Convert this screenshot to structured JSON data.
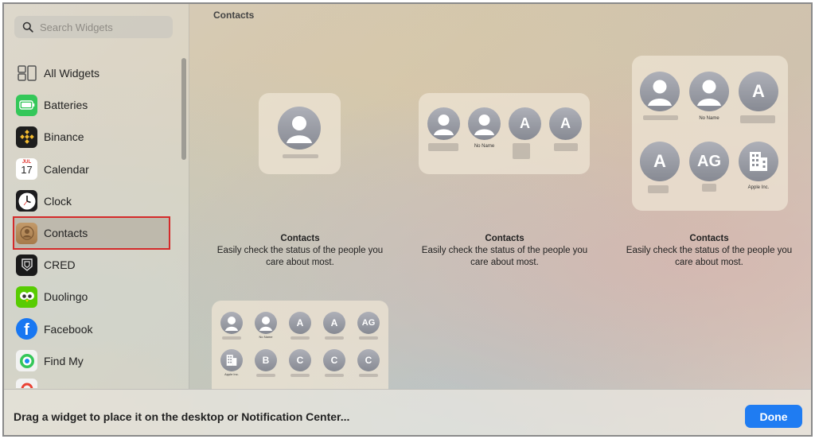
{
  "search": {
    "placeholder": "Search Widgets"
  },
  "sidebar": {
    "items": [
      {
        "label": "All Widgets",
        "icon": "all-widgets-icon"
      },
      {
        "label": "Batteries",
        "icon": "batteries-icon"
      },
      {
        "label": "Binance",
        "icon": "binance-icon"
      },
      {
        "label": "Calendar",
        "icon": "calendar-icon",
        "month": "JUL",
        "day": "17"
      },
      {
        "label": "Clock",
        "icon": "clock-icon"
      },
      {
        "label": "Contacts",
        "icon": "contacts-icon",
        "selected": true
      },
      {
        "label": "CRED",
        "icon": "cred-icon"
      },
      {
        "label": "Duolingo",
        "icon": "duolingo-icon"
      },
      {
        "label": "Facebook",
        "icon": "facebook-icon"
      },
      {
        "label": "Find My",
        "icon": "find-my-icon"
      }
    ]
  },
  "main": {
    "section_title": "Contacts",
    "widgets": [
      {
        "title": "Contacts",
        "description": "Easily check the status of the people you care about most."
      },
      {
        "title": "Contacts",
        "description": "Easily check the status of the people you care about most."
      },
      {
        "title": "Contacts",
        "description": "Easily check the status of the people you care about most."
      }
    ],
    "medium": {
      "labels": [
        "",
        "No Name",
        "",
        ""
      ],
      "letters": [
        "A",
        "A"
      ]
    },
    "large": {
      "labels": [
        "No Name",
        "Apple Inc."
      ],
      "letters": [
        "A",
        "A",
        "AG"
      ]
    },
    "xl": {
      "labels": [
        "No Name",
        "Apple Inc."
      ],
      "letters": [
        "A",
        "A",
        "AG",
        "B",
        "C",
        "C",
        "C"
      ]
    }
  },
  "bottom": {
    "hint": "Drag a widget to place it on the desktop or Notification Center...",
    "done_label": "Done"
  },
  "colors": {
    "accent": "#1f7cf2",
    "selection_outline": "#d42a2a"
  }
}
